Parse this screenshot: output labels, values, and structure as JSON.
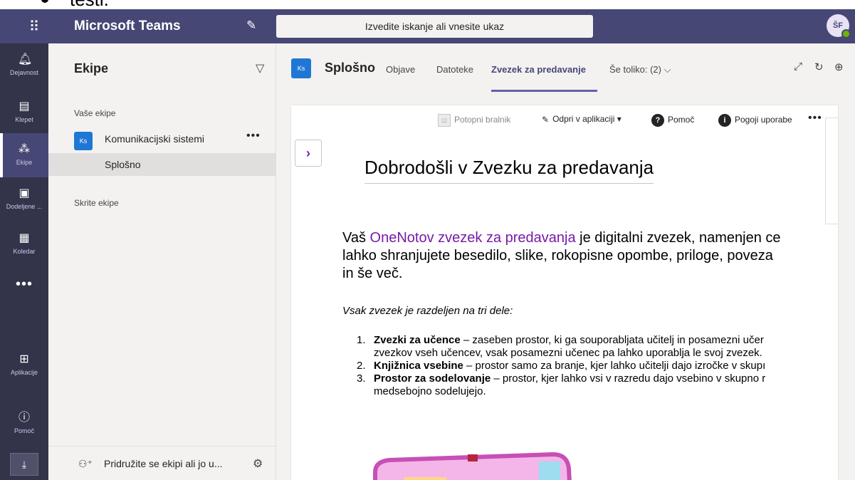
{
  "top": {
    "text_fragment": "testi."
  },
  "titlebar": {
    "app_title": "Microsoft Teams",
    "search_placeholder": "Izvedite iskanje ali vnesite ukaz",
    "user_initials": "ŠF"
  },
  "rail": {
    "items": [
      {
        "label": "Dejavnost",
        "icon": "bell-icon"
      },
      {
        "label": "Klepet",
        "icon": "chat-icon"
      },
      {
        "label": "Ekipe",
        "icon": "teams-icon"
      },
      {
        "label": "Dodeljene ...",
        "icon": "assignments-icon"
      },
      {
        "label": "Koledar",
        "icon": "calendar-icon"
      },
      {
        "label": "Aplikacije",
        "icon": "apps-icon"
      },
      {
        "label": "Pomoč",
        "icon": "help-icon"
      }
    ],
    "more": "•••"
  },
  "teams_panel": {
    "title": "Ekipe",
    "your_teams_label": "Vaše ekipe",
    "team": {
      "initials": "Ks",
      "name": "Komunikacijski sistemi",
      "more": "•••"
    },
    "channel": "Splošno",
    "hidden_teams_label": "Skrite ekipe",
    "join_label": "Pridružite se ekipi ali jo u..."
  },
  "channel": {
    "initials": "Ks",
    "name": "Splošno",
    "tabs": [
      {
        "label": "Objave"
      },
      {
        "label": "Datoteke"
      },
      {
        "label": "Zvezek za predavanje"
      },
      {
        "label": "Še toliko: (2) ⌵"
      }
    ]
  },
  "toolbar": {
    "immersive_reader": "Potopni bralnik",
    "open_in_app": "Odpri v aplikaciji",
    "help": "Pomoč",
    "terms": "Pogoji uporabe",
    "more": "•••"
  },
  "notebook": {
    "title": "Dobrodošli v Zvezku za predavanja",
    "intro_link": "OneNotov zvezek za predavanja",
    "intro_line1_prefix": "Vaš ",
    "intro_line1_suffix": " je digitalni zvezek, namenjen ce",
    "intro_line2": "lahko shranjujete besedilo, slike, rokopisne opombe, priloge, poveza",
    "intro_line3": "in še več.",
    "parts_heading": "Vsak zvezek je razdeljen na tri dele:",
    "items": [
      {
        "num": "1.",
        "bold": "Zvezki za učence",
        "text": " – zaseben prostor, ki ga souporabljata učitelj in posamezni učer",
        "cont": "zvezkov vseh učencev, vsak posamezni učenec pa lahko uporablja le svoj zvezek."
      },
      {
        "num": "2.",
        "bold": "Knjižnica vsebine",
        "text": " – prostor samo za branje, kjer lahko učitelji dajo izročke v skupı",
        "cont": ""
      },
      {
        "num": "3.",
        "bold": "Prostor za sodelovanje",
        "text": " – prostor, kjer lahko vsi v razredu dajo vsebino v skupno r",
        "cont": "medsebojno sodelujejo."
      }
    ]
  },
  "colors": {
    "titlebar": "#464775",
    "rail": "#33344a",
    "accent": "#6264a7",
    "link": "#7719aa"
  }
}
